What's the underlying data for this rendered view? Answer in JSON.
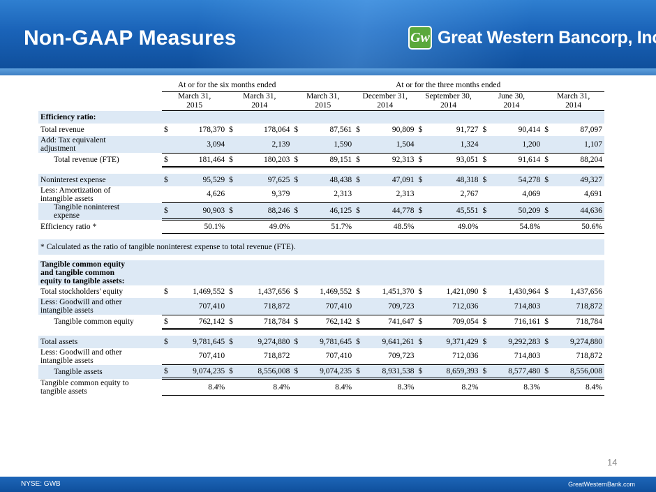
{
  "slide": {
    "title": "Non-GAAP Measures",
    "logo_text": "Great Western Bancorp, Inc.",
    "logo_mark": "Gw",
    "page_number": "14",
    "footer_left": "NYSE: GWB",
    "footer_right": "GreatWesternBank.com"
  },
  "table": {
    "span_headers": [
      "At or for the six months ended",
      "At or for the three months ended"
    ],
    "columns": [
      [
        "March 31,",
        "2015"
      ],
      [
        "March 31,",
        "2014"
      ],
      [
        "March 31,",
        "2015"
      ],
      [
        "December 31,",
        "2014"
      ],
      [
        "September 30,",
        "2014"
      ],
      [
        "June 30,",
        "2014"
      ],
      [
        "March 31,",
        "2014"
      ]
    ],
    "sections": {
      "efficiency": "Efficiency ratio:",
      "tangible": [
        "Tangible common equity",
        "and tangible common",
        "equity to tangible assets:"
      ]
    },
    "dollar": "$",
    "rows": [
      {
        "label": [
          "Total revenue"
        ],
        "values": [
          "178,370",
          "178,064",
          "87,561",
          "90,809",
          "91,727",
          "90,414",
          "87,097"
        ]
      },
      {
        "label": [
          "Add: Tax equivalent",
          "adjustment"
        ],
        "values": [
          "3,094",
          "2,139",
          "1,590",
          "1,504",
          "1,324",
          "1,200",
          "1,107"
        ]
      },
      {
        "label": [
          "Total revenue (FTE)"
        ],
        "values": [
          "181,464",
          "180,203",
          "89,151",
          "92,313",
          "93,051",
          "91,614",
          "88,204"
        ]
      },
      {
        "label": [
          "Noninterest expense"
        ],
        "values": [
          "95,529",
          "97,625",
          "48,438",
          "47,091",
          "48,318",
          "54,278",
          "49,327"
        ]
      },
      {
        "label": [
          "Less: Amortization of",
          "intangible assets"
        ],
        "values": [
          "4,626",
          "9,379",
          "2,313",
          "2,313",
          "2,767",
          "4,069",
          "4,691"
        ]
      },
      {
        "label": [
          "Tangible noninterest",
          "expense"
        ],
        "values": [
          "90,903",
          "88,246",
          "46,125",
          "44,778",
          "45,551",
          "50,209",
          "44,636"
        ]
      },
      {
        "label": [
          "Efficiency ratio *"
        ],
        "values": [
          "50.1%",
          "49.0%",
          "51.7%",
          "48.5%",
          "49.0%",
          "54.8%",
          "50.6%"
        ]
      },
      {
        "label": [
          "Total stockholders' equity"
        ],
        "values": [
          "1,469,552",
          "1,437,656",
          "1,469,552",
          "1,451,370",
          "1,421,090",
          "1,430,964",
          "1,437,656"
        ]
      },
      {
        "label": [
          "Less: Goodwill and other",
          "intangible assets"
        ],
        "values": [
          "707,410",
          "718,872",
          "707,410",
          "709,723",
          "712,036",
          "714,803",
          "718,872"
        ]
      },
      {
        "label": [
          "Tangible common equity"
        ],
        "values": [
          "762,142",
          "718,784",
          "762,142",
          "741,647",
          "709,054",
          "716,161",
          "718,784"
        ]
      },
      {
        "label": [
          "Total assets"
        ],
        "values": [
          "9,781,645",
          "9,274,880",
          "9,781,645",
          "9,641,261",
          "9,371,429",
          "9,292,283",
          "9,274,880"
        ]
      },
      {
        "label": [
          "Less: Goodwill and other",
          "intangible assets"
        ],
        "values": [
          "707,410",
          "718,872",
          "707,410",
          "709,723",
          "712,036",
          "714,803",
          "718,872"
        ]
      },
      {
        "label": [
          "Tangible assets"
        ],
        "values": [
          "9,074,235",
          "8,556,008",
          "9,074,235",
          "8,931,538",
          "8,659,393",
          "8,577,480",
          "8,556,008"
        ]
      },
      {
        "label": [
          "Tangible common equity to",
          "tangible assets"
        ],
        "values": [
          "8.4%",
          "8.4%",
          "8.4%",
          "8.3%",
          "8.2%",
          "8.3%",
          "8.4%"
        ]
      }
    ],
    "footnote": "* Calculated as the ratio of tangible noninterest expense to total revenue (FTE)."
  }
}
